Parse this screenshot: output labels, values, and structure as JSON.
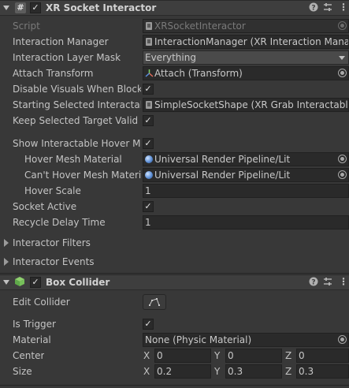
{
  "xr_component": {
    "title": "XR Socket Interactor",
    "enabled": true,
    "fields": {
      "script": {
        "label": "Script",
        "value": "XRSocketInteractor"
      },
      "interaction_manager": {
        "label": "Interaction Manager",
        "value": "InteractionManager (XR Interaction Mana"
      },
      "interaction_layer_mask": {
        "label": "Interaction Layer Mask",
        "value": "Everything"
      },
      "attach_transform": {
        "label": "Attach Transform",
        "value": "Attach (Transform)"
      },
      "disable_visuals": {
        "label": "Disable Visuals When Blocke",
        "checked": true
      },
      "starting_selected": {
        "label": "Starting Selected Interactable",
        "value": "SimpleSocketShape (XR Grab Interactabl"
      },
      "keep_selected": {
        "label": "Keep Selected Target Valid",
        "checked": true
      },
      "show_hover_mesh": {
        "label": "Show Interactable Hover Mes",
        "checked": true
      },
      "hover_mesh_material": {
        "label": "Hover Mesh Material",
        "value": "Universal Render Pipeline/Lit"
      },
      "cant_hover_mesh_material": {
        "label": "Can't Hover Mesh Materia",
        "value": "Universal Render Pipeline/Lit"
      },
      "hover_scale": {
        "label": "Hover Scale",
        "value": "1"
      },
      "socket_active": {
        "label": "Socket Active",
        "checked": true
      },
      "recycle_delay_time": {
        "label": "Recycle Delay Time",
        "value": "1"
      }
    },
    "foldouts": {
      "interactor_filters": "Interactor Filters",
      "interactor_events": "Interactor Events"
    }
  },
  "box_collider": {
    "title": "Box Collider",
    "enabled": true,
    "edit_collider_label": "Edit Collider",
    "is_trigger": {
      "label": "Is Trigger",
      "checked": true
    },
    "material": {
      "label": "Material",
      "value": "None (Physic Material)"
    },
    "center": {
      "label": "Center",
      "x_label": "X",
      "y_label": "Y",
      "z_label": "Z",
      "x": "0",
      "y": "0",
      "z": "0"
    },
    "size": {
      "label": "Size",
      "x_label": "X",
      "y_label": "Y",
      "z_label": "Z",
      "x": "0.2",
      "y": "0.3",
      "z": "0.3"
    }
  },
  "checkmark_glyph": "✓",
  "header_icons": [
    "help-icon",
    "presets-icon",
    "more-options-icon"
  ],
  "colors": {
    "background": "#383838",
    "header": "#3e3e3e",
    "field": "#2a2a2a",
    "text": "#c4c4c4"
  }
}
